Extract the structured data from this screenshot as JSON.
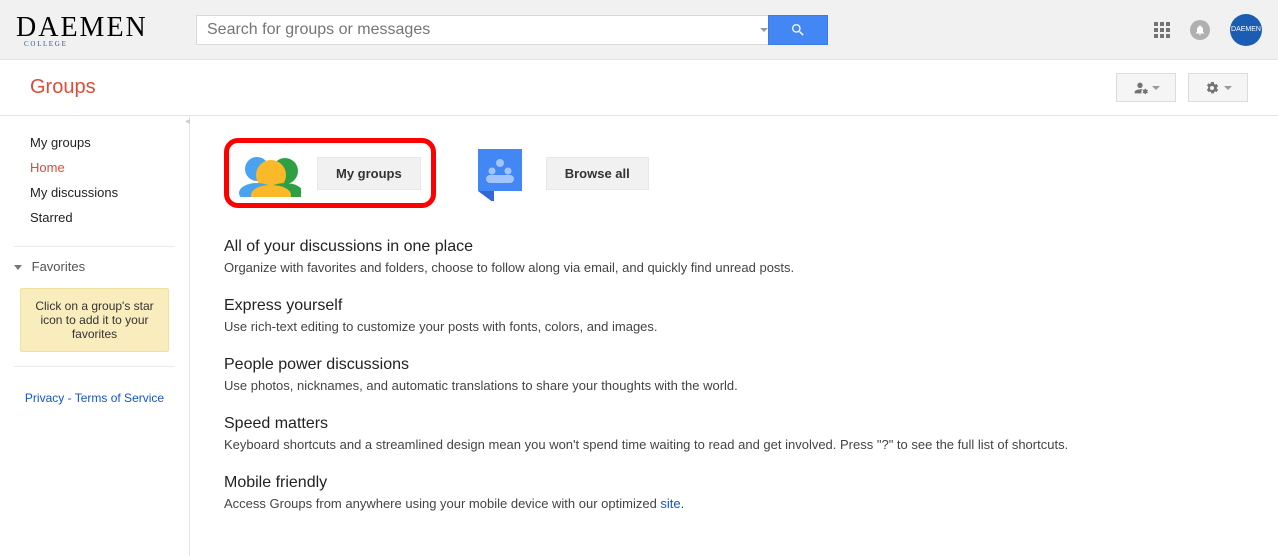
{
  "brand": {
    "name": "DAEMEN",
    "sub": "C O L L E G E",
    "avatar_text": "DAEMEN"
  },
  "search": {
    "placeholder": "Search for groups or messages"
  },
  "app_title": "Groups",
  "sidebar": {
    "nav": [
      {
        "label": "My groups",
        "active": false
      },
      {
        "label": "Home",
        "active": true
      },
      {
        "label": "My discussions",
        "active": false
      },
      {
        "label": "Starred",
        "active": false
      }
    ],
    "favorites_label": "Favorites",
    "favorites_tip": "Click on a group's star icon to add it to your favorites",
    "footer": {
      "privacy": "Privacy",
      "sep": " - ",
      "terms": "Terms of Service"
    }
  },
  "tiles": {
    "my_groups": "My groups",
    "browse_all": "Browse all"
  },
  "sections": [
    {
      "title": "All of your discussions in one place",
      "body": "Organize with favorites and folders, choose to follow along via email, and quickly find unread posts."
    },
    {
      "title": "Express yourself",
      "body": "Use rich-text editing to customize your posts with fonts, colors, and images."
    },
    {
      "title": "People power discussions",
      "body": "Use photos, nicknames, and automatic translations to share your thoughts with the world."
    },
    {
      "title": "Speed matters",
      "body": "Keyboard shortcuts and a streamlined design mean you won't spend time waiting to read and get involved. Press \"?\" to see the full list of shortcuts."
    },
    {
      "title": "Mobile friendly",
      "body_prefix": "Access Groups from anywhere using your mobile device with our optimized ",
      "link_text": "site",
      "body_suffix": "."
    }
  ],
  "icons": {
    "search": "search-icon",
    "apps": "apps-icon",
    "bell": "bell-icon",
    "person_settings": "person-settings-icon",
    "gear": "gear-icon",
    "group_people": "group-people-icon",
    "directory": "directory-icon"
  }
}
